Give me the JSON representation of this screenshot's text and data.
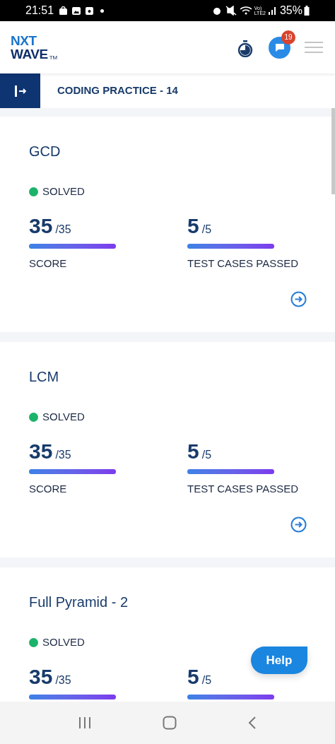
{
  "status_bar": {
    "time": "21:51",
    "network_top": "Vo)",
    "network_bottom": "LTE2",
    "battery": "35%"
  },
  "header": {
    "logo_top": "NXT",
    "logo_bottom": "WAVE",
    "logo_mark": "TM",
    "badge": "19"
  },
  "title_bar": {
    "title": "CODING PRACTICE - 14"
  },
  "cards": [
    {
      "title": "GCD",
      "status": "SOLVED",
      "metrics": [
        {
          "value": "35",
          "total": "/35",
          "level": 1,
          "label": "SCORE"
        },
        {
          "value": "5",
          "total": "/5",
          "level": 1,
          "label": "TEST CASES PASSED"
        }
      ]
    },
    {
      "title": "LCM",
      "status": "SOLVED",
      "metrics": [
        {
          "value": "35",
          "total": "/35",
          "level": 1,
          "label": "SCORE"
        },
        {
          "value": "5",
          "total": "/5",
          "level": 1,
          "label": "TEST CASES PASSED"
        }
      ]
    },
    {
      "title": "Full Pyramid - 2",
      "status": "SOLVED",
      "metrics": [
        {
          "value": "35",
          "total": "/35",
          "level": 1
        },
        {
          "value": "5",
          "total": "/5",
          "level": 1
        }
      ]
    }
  ],
  "help_button": {
    "label": "Help"
  }
}
